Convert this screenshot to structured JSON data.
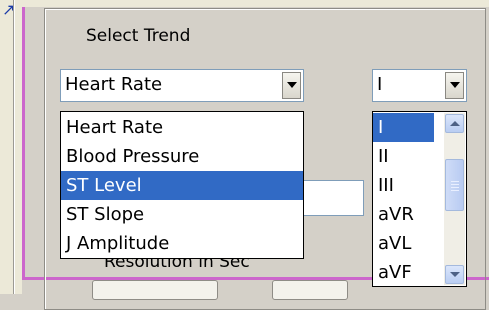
{
  "section_label": "Select Trend",
  "trend_combo": {
    "value": "Heart Rate"
  },
  "lead_combo": {
    "value": "I"
  },
  "trend_options": [
    {
      "label": "Heart Rate",
      "selected": false
    },
    {
      "label": "Blood Pressure",
      "selected": false
    },
    {
      "label": "ST Level",
      "selected": true
    },
    {
      "label": "ST Slope",
      "selected": false
    },
    {
      "label": "J Amplitude",
      "selected": false
    }
  ],
  "lead_options": [
    {
      "label": "I",
      "selected": true
    },
    {
      "label": "II",
      "selected": false
    },
    {
      "label": "III",
      "selected": false
    },
    {
      "label": "aVR",
      "selected": false
    },
    {
      "label": "aVL",
      "selected": false
    },
    {
      "label": "aVF",
      "selected": false
    }
  ],
  "partial_label": "Resolution in Sec",
  "colors": {
    "selection": "#316ac5",
    "frame": "#cc66cc"
  }
}
